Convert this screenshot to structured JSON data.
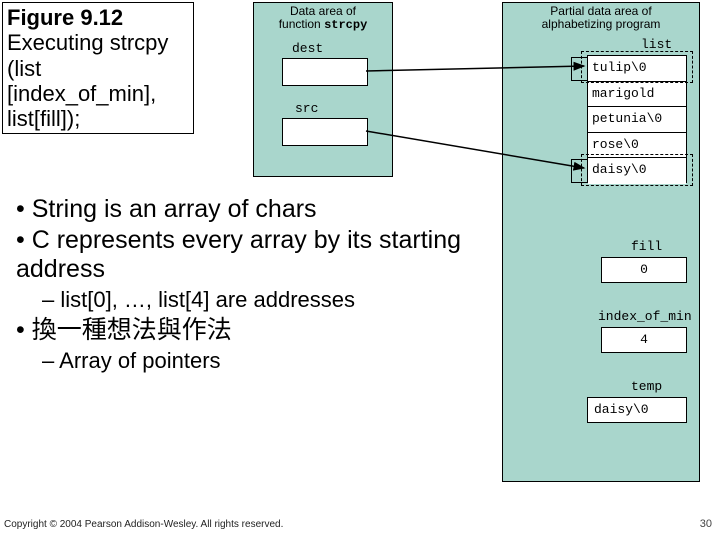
{
  "figure": {
    "label": "Figure 9.12",
    "caption": "Executing strcpy (list [index_of_min], list[fill]);"
  },
  "bullets": {
    "b1": "String is an array of chars",
    "b2": "C represents every array by its starting address",
    "sub1": "list[0], …, list[4] are addresses",
    "b3": "換一種想法與作法",
    "sub2": "Array of pointers"
  },
  "diagram": {
    "fn_panel_title_line1": "Data area of",
    "fn_panel_title_line2": "function",
    "fn_panel_title_mono": "strcpy",
    "dest_label": "dest",
    "src_label": "src",
    "alpha_title_line1": "Partial data area of",
    "alpha_title_line2": "alphabetizing program",
    "list_label": "list",
    "list": [
      "tulip\\0",
      "marigold",
      "petunia\\0",
      "rose\\0",
      "daisy\\0"
    ],
    "fill_label": "fill",
    "fill_value": "0",
    "iom_label": "index_of_min",
    "iom_value": "4",
    "temp_label": "temp",
    "temp_value": "daisy\\0"
  },
  "footer": {
    "copyright": "Copyright © 2004 Pearson Addison-Wesley. All rights reserved.",
    "pagenum": "30"
  }
}
